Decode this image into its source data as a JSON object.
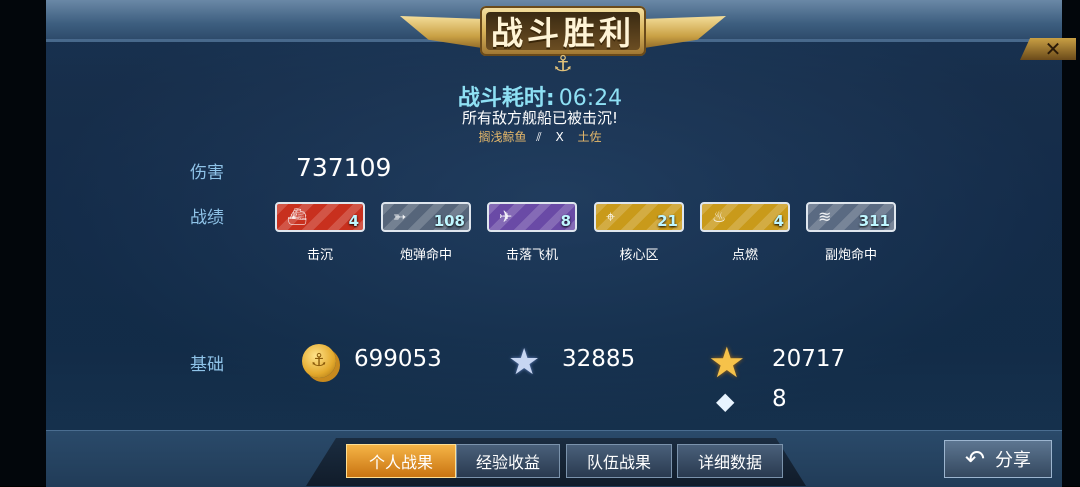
{
  "header": {
    "title": "战斗胜利",
    "close_glyph": "✕"
  },
  "battle": {
    "time_label": "战斗耗时:",
    "time_value": "06:24",
    "message": "所有敌方舰船已被击沉!",
    "attacker": "搁浅鲸鱼",
    "separator": "X",
    "target": "土佐"
  },
  "labels": {
    "damage": "伤害",
    "achievements": "战绩",
    "base": "基础"
  },
  "damage_value": "737109",
  "achievements": [
    {
      "icon": "ship-icon",
      "glyph": "⛴",
      "count": "4",
      "caption": "击沉",
      "color": "#c8301e"
    },
    {
      "icon": "shell-icon",
      "glyph": "➳",
      "count": "108",
      "caption": "炮弹命中",
      "color": "#56657a"
    },
    {
      "icon": "plane-icon",
      "glyph": "✈",
      "count": "8",
      "caption": "击落飞机",
      "color": "#6a4aa6"
    },
    {
      "icon": "core-icon",
      "glyph": "⌖",
      "count": "21",
      "caption": "核心区",
      "color": "#c99a1a"
    },
    {
      "icon": "fire-icon",
      "glyph": "♨",
      "count": "4",
      "caption": "点燃",
      "color": "#c99a1a"
    },
    {
      "icon": "secondary-gun-icon",
      "glyph": "≋",
      "count": "311",
      "caption": "副炮命中",
      "color": "#5a6a82"
    }
  ],
  "base": {
    "coins": "699053",
    "experience": "32885",
    "captain_xp": "20717",
    "diamonds": "8"
  },
  "tabs": [
    "个人战果",
    "经验收益",
    "队伍战果",
    "详细数据"
  ],
  "active_tab": 0,
  "share_label": "分享"
}
